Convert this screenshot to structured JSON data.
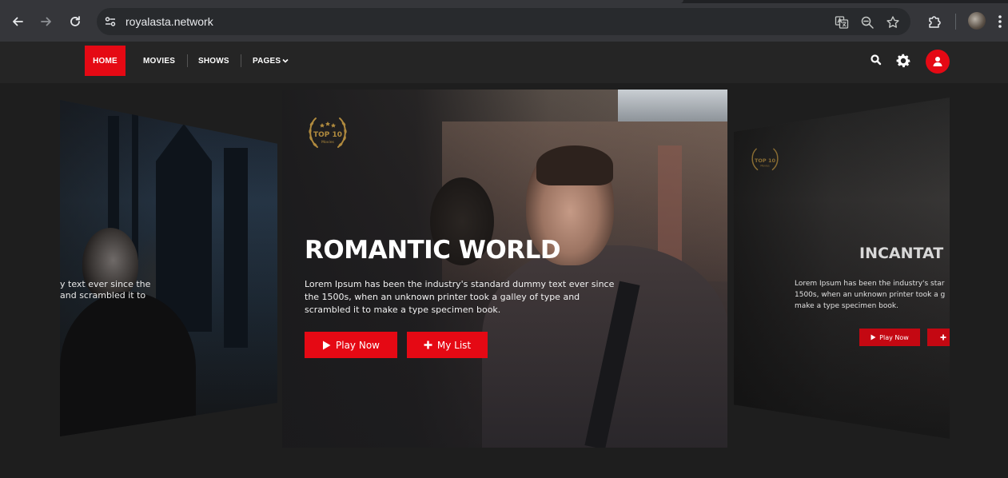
{
  "browser": {
    "url": "royalasta.network",
    "icons": [
      "back-icon",
      "forward-icon",
      "reload-icon",
      "site-settings-icon",
      "translate-icon",
      "zoom-icon",
      "bookmark-star-icon",
      "extensions-icon",
      "profile-avatar",
      "menu-dots-icon"
    ]
  },
  "nav": {
    "home": "HOME",
    "movies": "MOVIES",
    "shows": "SHOWS",
    "pages": "PAGES",
    "accent_color": "#e50914"
  },
  "slides": {
    "left": {
      "line1": "y text ever since the",
      "line2": "and scrambled it to"
    },
    "center": {
      "badge_text": "TOP 10",
      "badge_sub": "Movies",
      "title": "ROMANTIC WORLD",
      "description": "Lorem Ipsum has been the industry's standard dummy text ever since the 1500s, when an unknown printer took a galley of type and scrambled it to make a type specimen book.",
      "play_label": "Play Now",
      "list_label": "My List"
    },
    "right": {
      "badge_text": "TOP 10",
      "badge_sub": "Movies",
      "title": "INCANTAT",
      "line1": "Lorem Ipsum has been the industry's star",
      "line2": "1500s, when an unknown printer took a g",
      "line3": "make a type specimen book.",
      "play_label": "Play Now"
    }
  }
}
